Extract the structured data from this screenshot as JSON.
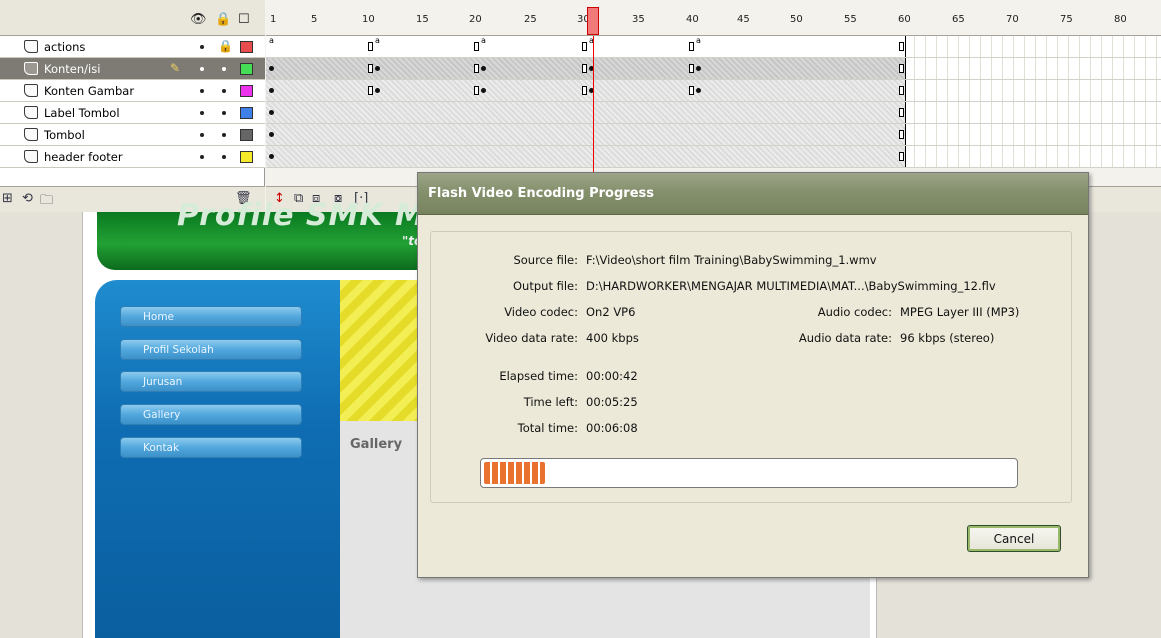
{
  "timeline": {
    "ruler_ticks": [
      "1",
      "5",
      "10",
      "15",
      "20",
      "25",
      "30",
      "35",
      "40",
      "45",
      "50",
      "55",
      "60",
      "65",
      "70",
      "75",
      "80"
    ],
    "current_frame": 31,
    "layers": [
      {
        "name": "actions",
        "color": "#e84c4c",
        "selected": false,
        "locked": true
      },
      {
        "name": "Konten/isi",
        "color": "#44dd55",
        "selected": true,
        "locked": false
      },
      {
        "name": "Konten Gambar",
        "color": "#ee33ee",
        "selected": false,
        "locked": false
      },
      {
        "name": "Label Tombol",
        "color": "#3f7fe8",
        "selected": false,
        "locked": false
      },
      {
        "name": "Tombol",
        "color": "#666666",
        "selected": false,
        "locked": false
      },
      {
        "name": "header footer",
        "color": "#f5ea2a",
        "selected": false,
        "locked": false
      }
    ],
    "header_icons": [
      "eye-icon",
      "lock-icon",
      "outline-icon"
    ],
    "frame_label_a": "a"
  },
  "stage": {
    "banner_title": "Profile SMK Muha",
    "banner_subtitle": "\"to",
    "nav_items": [
      "Home",
      "Profil Sekolah",
      "Jurusan",
      "Gallery",
      "Kontak"
    ],
    "content_title": "Gallery"
  },
  "dialog": {
    "title": "Flash Video Encoding Progress",
    "source_file_label": "Source file:",
    "source_file": "F:\\Video\\short film Training\\BabySwimming_1.wmv",
    "output_file_label": "Output file:",
    "output_file": "D:\\HARDWORKER\\MENGAJAR MULTIMEDIA\\MAT...\\BabySwimming_12.flv",
    "video_codec_label": "Video codec:",
    "video_codec": "On2 VP6",
    "audio_codec_label": "Audio codec:",
    "audio_codec": "MPEG Layer III (MP3)",
    "video_rate_label": "Video data rate:",
    "video_rate": "400 kbps",
    "audio_rate_label": "Audio data rate:",
    "audio_rate": "96 kbps (stereo)",
    "elapsed_label": "Elapsed time:",
    "elapsed": "00:00:42",
    "left_label": "Time left:",
    "left": "00:05:25",
    "total_label": "Total time:",
    "total": "00:06:08",
    "progress_fraction": 0.115,
    "cancel_label": "Cancel"
  }
}
